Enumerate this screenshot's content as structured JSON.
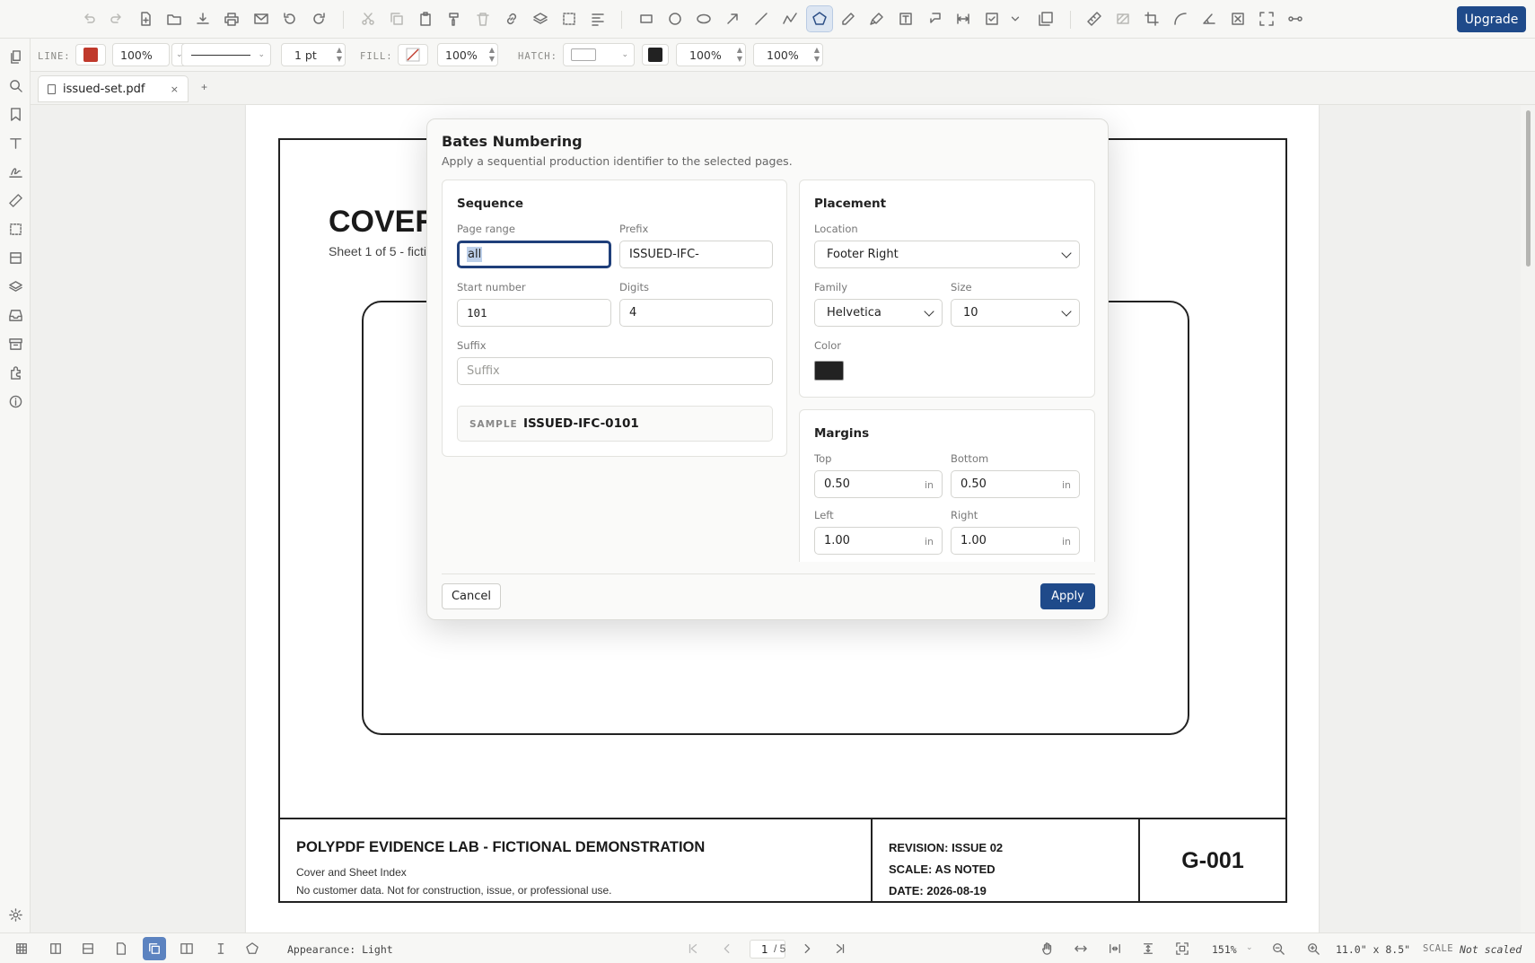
{
  "toolbar": {
    "upgrade_label": "Upgrade",
    "active_tool": "polygon-icon"
  },
  "properties": {
    "line_label": "LINE:",
    "line_color": "#c0392b",
    "line_opacity": "100%",
    "line_width": "1 pt",
    "fill_label": "FILL:",
    "fill_opacity": "100%",
    "hatch_label": "HATCH:",
    "hatch_color": "#222222",
    "hatch_opacity": "100%",
    "extra_opacity": "100%"
  },
  "tabs": [
    {
      "label": "issued-set.pdf",
      "close": "×"
    }
  ],
  "tab_add": "+",
  "document": {
    "cover_title": "COVER",
    "cover_sub": "Sheet 1 of 5 - ficti",
    "titleblock": {
      "main": "POLYPDF EVIDENCE LAB - FICTIONAL DEMONSTRATION",
      "line1": "Cover and Sheet Index",
      "line2": "No customer data. Not for construction, issue, or professional use.",
      "revision": "REVISION: ISSUE 02",
      "scale": "SCALE: AS NOTED",
      "date": "DATE: 2026-08-19",
      "sheet": "G-001"
    }
  },
  "dialog": {
    "title": "Bates Numbering",
    "subtitle": "Apply a sequential production identifier to the selected pages.",
    "sequence": {
      "title": "Sequence",
      "page_range_label": "Page range",
      "page_range_value": "all",
      "prefix_label": "Prefix",
      "prefix_value": "ISSUED-IFC-",
      "start_label": "Start number",
      "start_value": "101",
      "digits_label": "Digits",
      "digits_value": "4",
      "suffix_label": "Suffix",
      "suffix_placeholder": "Suffix",
      "sample_label": "SAMPLE",
      "sample_value": "ISSUED-IFC-0101"
    },
    "placement": {
      "title": "Placement",
      "location_label": "Location",
      "location_value": "Footer Right",
      "family_label": "Family",
      "family_value": "Helvetica",
      "size_label": "Size",
      "size_value": "10",
      "color_label": "Color",
      "color_value": "#222222"
    },
    "margins": {
      "title": "Margins",
      "top_label": "Top",
      "top_value": "0.50",
      "bottom_label": "Bottom",
      "bottom_value": "0.50",
      "left_label": "Left",
      "left_value": "1.00",
      "right_label": "Right",
      "right_value": "1.00",
      "unit": "in"
    },
    "cancel_label": "Cancel",
    "apply_label": "Apply"
  },
  "status": {
    "appearance": "Appearance: Light",
    "page_current": "1",
    "page_total": "/ 5",
    "zoom": "151%",
    "page_size": "11.0\" x 8.5\"",
    "scale_label": "SCALE",
    "scale_value": "Not scaled"
  }
}
